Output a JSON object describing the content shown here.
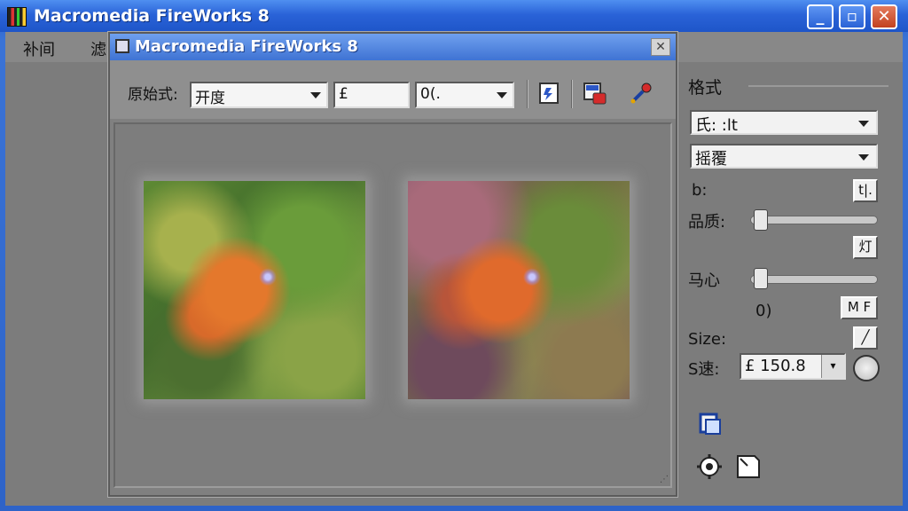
{
  "outer_window": {
    "title": "Macromedia FireWorks 8",
    "menu": [
      "补间",
      "滤"
    ]
  },
  "dialog": {
    "title": "Macromedia FireWorks 8",
    "toolbar": {
      "mode_label": "原始式:",
      "mode_value": "开度",
      "field2_value": "£",
      "field3_value": "0(."
    }
  },
  "panel": {
    "title": "格式",
    "format_value": "氏: :lt",
    "palette_value": "摇覆",
    "b_label": "b:",
    "b_button": "t|.",
    "quality_label": "品质:",
    "quality_button": "灯",
    "quality_level": 0.05,
    "smooth_label": "马心",
    "smooth_level": 0.05,
    "smooth_value": "0)",
    "smooth_button": "M F",
    "size_label": "Size:",
    "s_label": "S速:",
    "size_value": "£ 150.8"
  },
  "icons": {
    "toolbar": [
      "optimize-icon",
      "export-icon",
      "eyedropper-icon"
    ],
    "bottom": [
      "export-wizard-icon",
      "settings-icon",
      "crop-icon"
    ]
  }
}
